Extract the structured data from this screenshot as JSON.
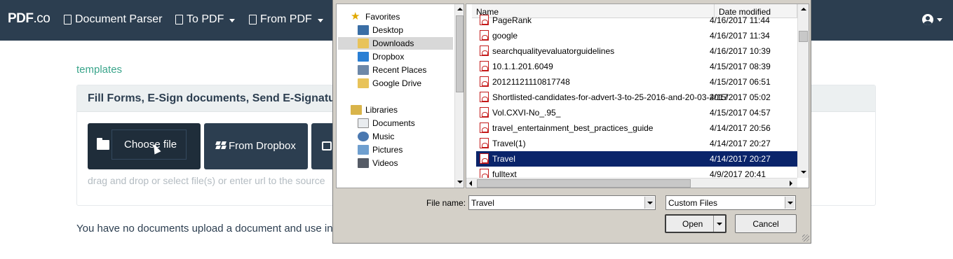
{
  "navbar": {
    "brand_main": "PDF",
    "brand_suffix": ".co",
    "items": [
      {
        "label": "Document Parser"
      },
      {
        "label": "To PDF"
      },
      {
        "label": "From PDF"
      }
    ]
  },
  "page": {
    "templates_link": "templates",
    "panel_title": "Fill Forms, E-Sign documents, Send E-Signature",
    "choose_file": "Choose file",
    "from_dropbox": "From Dropbox",
    "drag_hint": "drag and drop or select file(s) or enter url to the source",
    "no_docs": "You have no documents upload a document and use invit"
  },
  "dialog": {
    "nav_tree": [
      {
        "label": "Favorites",
        "icon": "star-icon"
      },
      {
        "label": "Desktop",
        "icon": "desktop-icon"
      },
      {
        "label": "Downloads",
        "icon": "downloads-folder-icon",
        "selected": true
      },
      {
        "label": "Dropbox",
        "icon": "dropbox-icon"
      },
      {
        "label": "Recent Places",
        "icon": "recent-places-icon"
      },
      {
        "label": "Google Drive",
        "icon": "google-drive-icon"
      },
      {
        "label": "Libraries",
        "icon": "libraries-icon"
      },
      {
        "label": "Documents",
        "icon": "documents-icon"
      },
      {
        "label": "Music",
        "icon": "music-icon"
      },
      {
        "label": "Pictures",
        "icon": "pictures-icon"
      },
      {
        "label": "Videos",
        "icon": "videos-icon"
      }
    ],
    "columns": {
      "name": "Name",
      "date_modified": "Date modified"
    },
    "files": [
      {
        "name": "PageRank",
        "date": "4/16/2017 11:44"
      },
      {
        "name": "google",
        "date": "4/16/2017 11:34"
      },
      {
        "name": "searchqualityevaluatorguidelines",
        "date": "4/16/2017 10:39"
      },
      {
        "name": "10.1.1.201.6049",
        "date": "4/15/2017 08:39"
      },
      {
        "name": "20121121110817748",
        "date": "4/15/2017 06:51"
      },
      {
        "name": "Shortlisted-candidates-for-advert-3-to-25-2016-and-20-03-2017",
        "date": "4/15/2017 05:02"
      },
      {
        "name": "Vol.CXVI-No_.95_",
        "date": "4/15/2017 04:57"
      },
      {
        "name": "travel_entertainment_best_practices_guide",
        "date": "4/14/2017 20:56"
      },
      {
        "name": "Travel(1)",
        "date": "4/14/2017 20:27"
      },
      {
        "name": "Travel",
        "date": "4/14/2017 20:27",
        "selected": true
      },
      {
        "name": "fulltext",
        "date": "4/9/2017 20:41"
      }
    ],
    "file_name_label": "File name:",
    "file_name_value": "Travel",
    "file_type_value": "Custom Files",
    "open_label": "Open",
    "cancel_label": "Cancel",
    "colors": {
      "selection": "#0a246a",
      "navbar": "#2c3e50",
      "accent": "#3aa58b"
    }
  }
}
